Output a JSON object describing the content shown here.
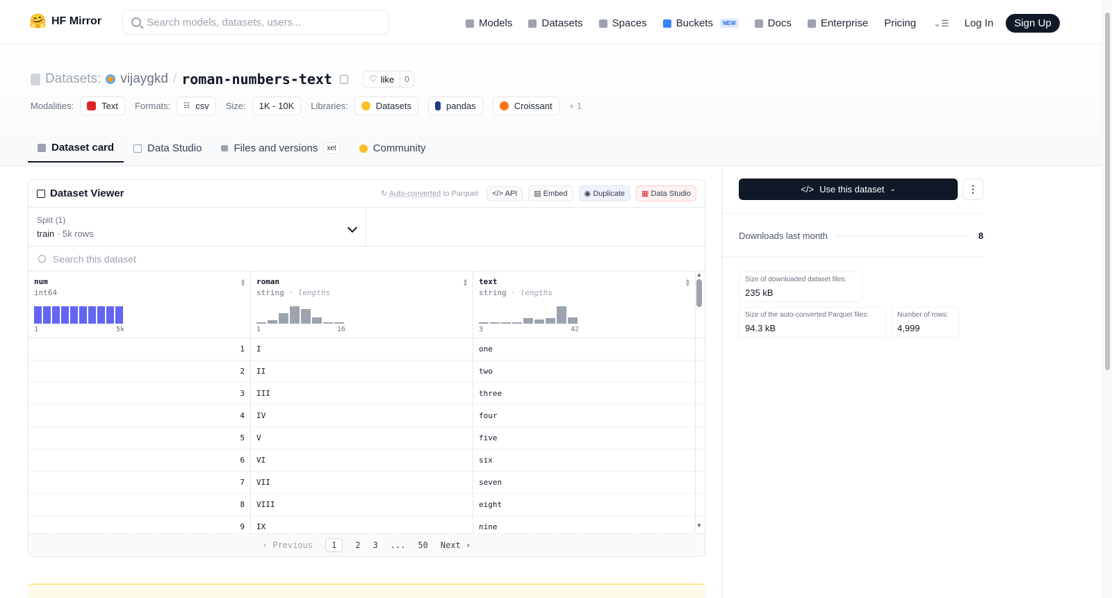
{
  "nav": {
    "brand": "HF Mirror",
    "search_placeholder": "Search models, datasets, users...",
    "links": [
      "Models",
      "Datasets",
      "Spaces",
      "Buckets",
      "Docs",
      "Enterprise",
      "Pricing"
    ],
    "buckets_badge": "NEW",
    "login": "Log In",
    "signup": "Sign Up"
  },
  "header": {
    "section_label": "Datasets:",
    "user": "vijaygkd",
    "slash": "/",
    "repo": "roman-numbers-text",
    "like_label": "like",
    "like_count": "0",
    "modalities_label": "Modalities:",
    "modality": "Text",
    "formats_label": "Formats:",
    "format": "csv",
    "size_label": "Size:",
    "size": "1K - 10K",
    "libraries_label": "Libraries:",
    "libraries": [
      "Datasets",
      "pandas",
      "Croissant"
    ],
    "more_libraries": "+ 1"
  },
  "tabs": [
    "Dataset card",
    "Data Studio",
    "Files and versions",
    "Community"
  ],
  "xet_label": "xet",
  "viewer": {
    "title": "Dataset Viewer",
    "auto_converted_link": "Auto-converted",
    "auto_converted_rest": " to Parquet",
    "buttons": [
      "API",
      "Embed",
      "Duplicate",
      "Data Studio"
    ],
    "split_label": "Split (1)",
    "split_name": "train",
    "split_rows": "· 5k rows",
    "search_placeholder": "Search this dataset",
    "columns": [
      {
        "name": "num",
        "type": "int64",
        "subtype": "",
        "min": "1",
        "max": "5k",
        "hist": [
          1,
          1,
          1,
          1,
          1,
          1,
          1,
          1,
          1,
          1
        ]
      },
      {
        "name": "roman",
        "type": "string",
        "subtype": "· lengths",
        "min": "1",
        "max": "16",
        "hist": [
          0.05,
          0.2,
          0.6,
          1,
          0.85,
          0.35,
          0.08,
          0.03
        ]
      },
      {
        "name": "text",
        "type": "string",
        "subtype": "· lengths",
        "min": "3",
        "max": "42",
        "hist": [
          0.03,
          0.05,
          0.05,
          0.08,
          0.3,
          0.25,
          0.3,
          1,
          0.35
        ]
      }
    ],
    "rows": [
      [
        "1",
        "I",
        "one"
      ],
      [
        "2",
        "II",
        "two"
      ],
      [
        "3",
        "III",
        "three"
      ],
      [
        "4",
        "IV",
        "four"
      ],
      [
        "5",
        "V",
        "five"
      ],
      [
        "6",
        "VI",
        "six"
      ],
      [
        "7",
        "VII",
        "seven"
      ],
      [
        "8",
        "VIII",
        "eight"
      ],
      [
        "9",
        "IX",
        "nine"
      ]
    ],
    "pager": {
      "prev": "Previous",
      "pages": [
        "1",
        "2",
        "3",
        "...",
        "50"
      ],
      "next": "Next"
    }
  },
  "sidebar": {
    "use_button": "Use this dataset",
    "downloads_label": "Downloads last month",
    "downloads_value": "8",
    "stats": [
      {
        "label": "Size of downloaded dataset files:",
        "value": "235 kB"
      },
      {
        "label": "Size of the auto-converted Parquet files:",
        "value": "94.3 kB"
      },
      {
        "label": "Number of rows:",
        "value": "4,999"
      }
    ]
  },
  "colors": {
    "accent_dark": "#111827",
    "hist_blue": "#6366f1",
    "hist_gray": "#9ca3af"
  }
}
